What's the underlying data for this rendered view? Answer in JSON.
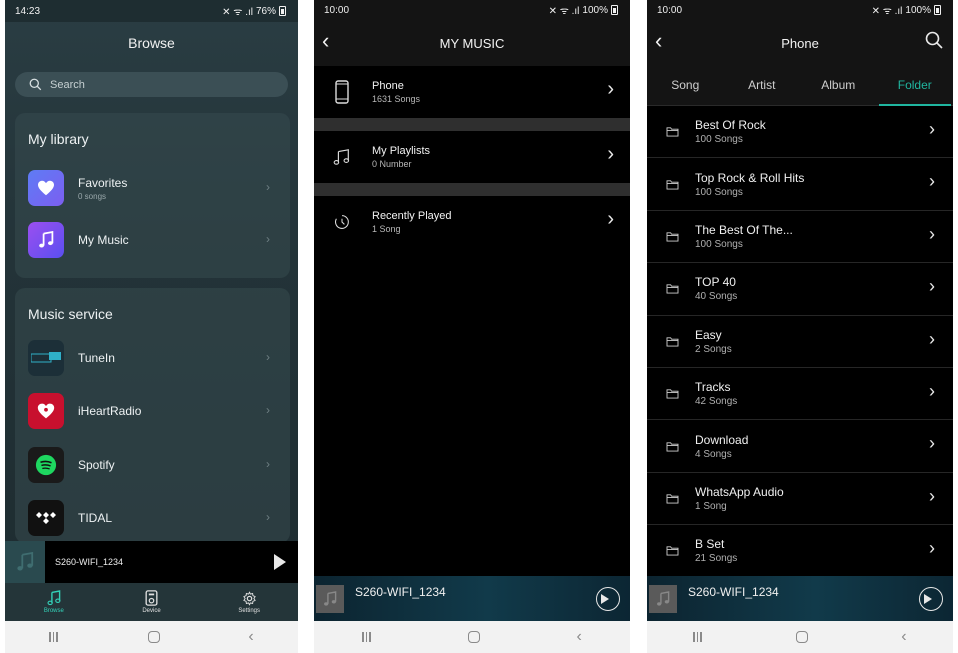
{
  "panel1": {
    "status": {
      "time": "14:23",
      "signal": "✕ ᯤ .ıl",
      "battery": "76%"
    },
    "title": "Browse",
    "search_placeholder": "Search",
    "library": {
      "title": "My library",
      "items": [
        {
          "label": "Favorites",
          "sub": "0 songs",
          "icon": "heart-icon",
          "color": "#6f6cf0"
        },
        {
          "label": "My Music",
          "sub": "",
          "icon": "music-note-icon",
          "color": "#7a4ff0"
        }
      ]
    },
    "service": {
      "title": "Music service",
      "items": [
        {
          "label": "TuneIn",
          "icon": "tunein-logo",
          "color": "#1b3a4a"
        },
        {
          "label": "iHeartRadio",
          "icon": "iheartradio-logo",
          "color": "#c8102e"
        },
        {
          "label": "Spotify",
          "icon": "spotify-logo",
          "color": "#1a1a1a"
        },
        {
          "label": "TIDAL",
          "icon": "tidal-logo",
          "color": "#111111"
        }
      ]
    },
    "mini_player": {
      "device": "S260-WIFI_1234"
    },
    "tabs": [
      {
        "label": "Browse",
        "icon": "music-note-icon",
        "active": true
      },
      {
        "label": "Device",
        "icon": "device-icon",
        "active": false
      },
      {
        "label": "Settings",
        "icon": "gear-icon",
        "active": false
      }
    ]
  },
  "panel2": {
    "status": {
      "time": "10:00",
      "signal": "✕ ᯤ .ıl",
      "battery": "100%"
    },
    "title": "MY MUSIC",
    "items": [
      {
        "label": "Phone",
        "sub": "1631 Songs",
        "icon": "phone-icon"
      },
      {
        "label": "My Playlists",
        "sub": "0 Number",
        "icon": "playlist-icon"
      },
      {
        "label": "Recently Played",
        "sub": "1 Song",
        "icon": "clock-icon"
      }
    ],
    "mini_player": {
      "device": "S260-WIFI_1234"
    }
  },
  "panel3": {
    "status": {
      "time": "10:00",
      "signal": "✕ ᯤ .ıl",
      "battery": "100%"
    },
    "title": "Phone",
    "filters": [
      "Song",
      "Artist",
      "Album",
      "Folder"
    ],
    "active_filter": "Folder",
    "accent": "#20b6a0",
    "folders": [
      {
        "name": "Best Of Rock",
        "count": "100 Songs"
      },
      {
        "name": "Top Rock & Roll Hits",
        "count": "100 Songs"
      },
      {
        "name": "The Best Of The...",
        "count": "100 Songs"
      },
      {
        "name": "TOP 40",
        "count": "40 Songs"
      },
      {
        "name": "Easy",
        "count": "2 Songs"
      },
      {
        "name": "Tracks",
        "count": "42 Songs"
      },
      {
        "name": "Download",
        "count": "4 Songs"
      },
      {
        "name": "WhatsApp Audio",
        "count": "1 Song"
      },
      {
        "name": "B Set",
        "count": "21 Songs"
      }
    ],
    "mini_player": {
      "device": "S260-WIFI_1234"
    }
  }
}
